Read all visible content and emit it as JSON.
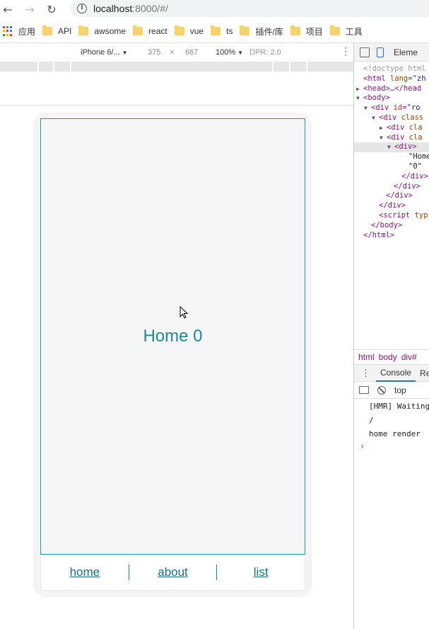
{
  "browser": {
    "url_host": "localhost",
    "url_rest": ":8000/#/",
    "bookmarks": [
      {
        "label": "应用"
      },
      {
        "label": "API"
      },
      {
        "label": "awsome"
      },
      {
        "label": "react"
      },
      {
        "label": "vue"
      },
      {
        "label": "ts"
      },
      {
        "label": "插件/库"
      },
      {
        "label": "项目"
      },
      {
        "label": "工具"
      }
    ]
  },
  "device_toolbar": {
    "device": "iPhone 6/...",
    "width": "375",
    "times": "×",
    "height": "667",
    "zoom": "100%",
    "dpr": "DPR: 2.0"
  },
  "app": {
    "home_text": "Home 0",
    "tabs": [
      {
        "label": "home"
      },
      {
        "label": "about"
      },
      {
        "label": "list"
      }
    ]
  },
  "devtools": {
    "elements_tab": "Eleme",
    "breadcrumb": [
      "html",
      "body",
      "div#"
    ],
    "console_tab": "Console",
    "console_tab2": "Re",
    "context": "top",
    "messages": [
      "[HMR] Waiting",
      "/",
      "home render"
    ]
  },
  "colors": {
    "accent": "#1a8a99",
    "link": "#1a6f80",
    "frame": "#1e9ab0"
  }
}
